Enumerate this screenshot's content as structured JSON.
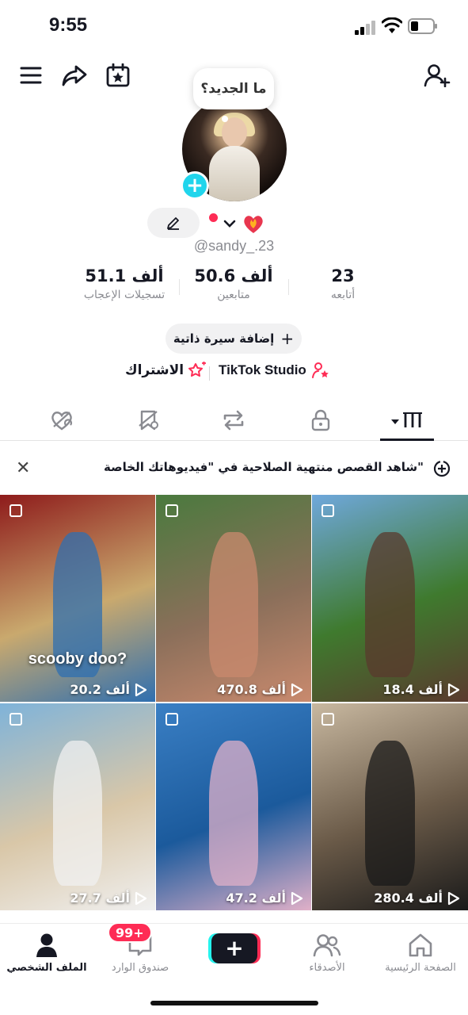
{
  "status_bar": {
    "time": "9:55"
  },
  "profile": {
    "bubble": "ما الجديد؟",
    "handle": "@sandy_.23",
    "stats": [
      {
        "value": "23",
        "label": "أتابعه"
      },
      {
        "value": "50.6 ألف",
        "label": "متابعين"
      },
      {
        "value": "51.1 ألف",
        "label": "تسجيلات الإعجاب"
      }
    ],
    "bio_button": "إضافة سيرة ذاتية",
    "links": {
      "studio": "TikTok Studio",
      "subscription": "الاشتراك"
    }
  },
  "banner": {
    "text": "شاهد القصص منتهية الصلاحية في \"فيديوهاتك الخاصة\""
  },
  "videos": [
    {
      "views": "20.2 ألف",
      "caption": "scooby doo?",
      "colors": [
        "#8e1b1b",
        "#c9a96e",
        "#2f6fb0"
      ]
    },
    {
      "views": "470.8 ألف",
      "caption": "",
      "colors": [
        "#4a7a3e",
        "#8b6f5a",
        "#c98a6e"
      ]
    },
    {
      "views": "18.4 ألف",
      "caption": "",
      "colors": [
        "#6fa8dc",
        "#3f7a2e",
        "#5a3a2e"
      ]
    },
    {
      "views": "27.7 ألف",
      "caption": "",
      "colors": [
        "#7fb3d9",
        "#d9c7a8",
        "#f0f0f0"
      ]
    },
    {
      "views": "47.2 ألف",
      "caption": "",
      "colors": [
        "#3a7fc4",
        "#1b5a9c",
        "#e0b0c8"
      ]
    },
    {
      "views": "280.4 ألف",
      "caption": "",
      "colors": [
        "#c8b8a0",
        "#6a5a48",
        "#1a1a1a"
      ]
    }
  ],
  "bottom_nav": {
    "profile": "الملف الشخصي",
    "inbox": "صندوق الوارد",
    "inbox_badge": "99+",
    "friends": "الأصدقاء",
    "home": "الصفحة الرئيسية"
  }
}
